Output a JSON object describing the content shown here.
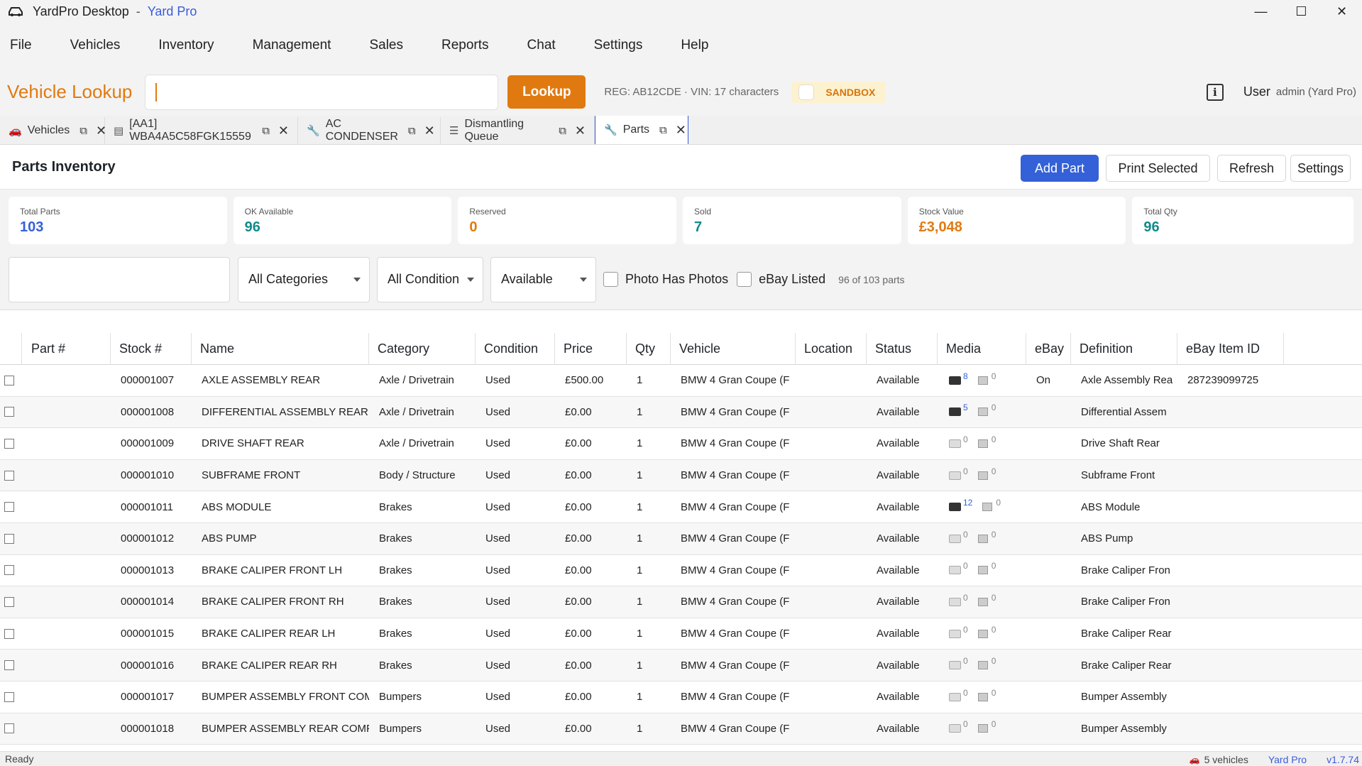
{
  "window": {
    "app_name": "YardPro Desktop",
    "separator": "-",
    "brand": "Yard Pro",
    "controls": {
      "minimize": "—",
      "maximize": "☐",
      "close": "✕"
    }
  },
  "menu": [
    "File",
    "Vehicles",
    "Inventory",
    "Management",
    "Sales",
    "Reports",
    "Chat",
    "Settings",
    "Help"
  ],
  "lookup": {
    "title": "Vehicle Lookup",
    "input_value": "",
    "button": "Lookup",
    "hint": "REG: AB12CDE · VIN: 17 characters",
    "sandbox_label": "SANDBOX",
    "user_label": "User",
    "user_value": "admin (Yard Pro)"
  },
  "tabs": [
    {
      "label": "Vehicles",
      "icon": "car-icon"
    },
    {
      "label": "[AA1] WBA4A5C58FGK15559",
      "icon": "document-icon"
    },
    {
      "label": "AC CONDENSER",
      "icon": "wrench-icon"
    },
    {
      "label": "Dismantling Queue",
      "icon": "queue-icon"
    },
    {
      "label": "Parts",
      "icon": "wrench-icon"
    }
  ],
  "parts": {
    "title": "Parts Inventory",
    "buttons": {
      "add": "Add Part",
      "print": "Print Selected",
      "refresh": "Refresh",
      "settings": "Settings"
    }
  },
  "stats": [
    {
      "label": "Total Parts",
      "value": "103",
      "color": "#3461d8"
    },
    {
      "label": "OK Available",
      "value": "96",
      "color": "#138a8a"
    },
    {
      "label": "Reserved",
      "value": "0",
      "color": "#e07a10"
    },
    {
      "label": "Sold",
      "value": "7",
      "color": "#138a8a"
    },
    {
      "label": "Stock Value",
      "value": "£3,048",
      "color": "#e07a10"
    },
    {
      "label": "Total Qty",
      "value": "96",
      "color": "#138a8a"
    }
  ],
  "filters": {
    "category": "All Categories",
    "condition": "All Condition",
    "status": "Available",
    "photo_label": "Photo Has Photos",
    "ebay_label": "eBay Listed",
    "count": "96 of 103 parts"
  },
  "columns": [
    "Part #",
    "Stock #",
    "Name",
    "Category",
    "Condition",
    "Price",
    "Qty",
    "Vehicle",
    "Location",
    "Status",
    "Media",
    "eBay",
    "Definition",
    "eBay Item ID"
  ],
  "rows": [
    {
      "part": "",
      "stock": "000001007",
      "name": "AXLE ASSEMBLY REAR",
      "category": "Axle / Drivetrain",
      "condition": "Used",
      "price": "£500.00",
      "qty": "1",
      "vehicle": "BMW 4 Gran Coupe (F",
      "location": "",
      "status": "Available",
      "photos": "8",
      "videos": "0",
      "ebay": "On",
      "definition": "Axle Assembly Rea",
      "ebay_id": "287239099725"
    },
    {
      "part": "",
      "stock": "000001008",
      "name": "DIFFERENTIAL ASSEMBLY REAR",
      "category": "Axle / Drivetrain",
      "condition": "Used",
      "price": "£0.00",
      "qty": "1",
      "vehicle": "BMW 4 Gran Coupe (F",
      "location": "",
      "status": "Available",
      "photos": "5",
      "videos": "0",
      "ebay": "",
      "definition": "Differential Assem",
      "ebay_id": ""
    },
    {
      "part": "",
      "stock": "000001009",
      "name": "DRIVE SHAFT REAR",
      "category": "Axle / Drivetrain",
      "condition": "Used",
      "price": "£0.00",
      "qty": "1",
      "vehicle": "BMW 4 Gran Coupe (F",
      "location": "",
      "status": "Available",
      "photos": "0",
      "videos": "0",
      "ebay": "",
      "definition": "Drive Shaft Rear",
      "ebay_id": ""
    },
    {
      "part": "",
      "stock": "000001010",
      "name": "SUBFRAME FRONT",
      "category": "Body / Structure",
      "condition": "Used",
      "price": "£0.00",
      "qty": "1",
      "vehicle": "BMW 4 Gran Coupe (F",
      "location": "",
      "status": "Available",
      "photos": "0",
      "videos": "0",
      "ebay": "",
      "definition": "Subframe Front",
      "ebay_id": ""
    },
    {
      "part": "",
      "stock": "000001011",
      "name": "ABS MODULE",
      "category": "Brakes",
      "condition": "Used",
      "price": "£0.00",
      "qty": "1",
      "vehicle": "BMW 4 Gran Coupe (F",
      "location": "",
      "status": "Available",
      "photos": "12",
      "videos": "0",
      "ebay": "",
      "definition": "ABS Module",
      "ebay_id": ""
    },
    {
      "part": "",
      "stock": "000001012",
      "name": "ABS PUMP",
      "category": "Brakes",
      "condition": "Used",
      "price": "£0.00",
      "qty": "1",
      "vehicle": "BMW 4 Gran Coupe (F",
      "location": "",
      "status": "Available",
      "photos": "0",
      "videos": "0",
      "ebay": "",
      "definition": "ABS Pump",
      "ebay_id": ""
    },
    {
      "part": "",
      "stock": "000001013",
      "name": "BRAKE CALIPER FRONT LH",
      "category": "Brakes",
      "condition": "Used",
      "price": "£0.00",
      "qty": "1",
      "vehicle": "BMW 4 Gran Coupe (F",
      "location": "",
      "status": "Available",
      "photos": "0",
      "videos": "0",
      "ebay": "",
      "definition": "Brake Caliper Fron",
      "ebay_id": ""
    },
    {
      "part": "",
      "stock": "000001014",
      "name": "BRAKE CALIPER FRONT RH",
      "category": "Brakes",
      "condition": "Used",
      "price": "£0.00",
      "qty": "1",
      "vehicle": "BMW 4 Gran Coupe (F",
      "location": "",
      "status": "Available",
      "photos": "0",
      "videos": "0",
      "ebay": "",
      "definition": "Brake Caliper Fron",
      "ebay_id": ""
    },
    {
      "part": "",
      "stock": "000001015",
      "name": "BRAKE CALIPER REAR LH",
      "category": "Brakes",
      "condition": "Used",
      "price": "£0.00",
      "qty": "1",
      "vehicle": "BMW 4 Gran Coupe (F",
      "location": "",
      "status": "Available",
      "photos": "0",
      "videos": "0",
      "ebay": "",
      "definition": "Brake Caliper Rear",
      "ebay_id": ""
    },
    {
      "part": "",
      "stock": "000001016",
      "name": "BRAKE CALIPER REAR RH",
      "category": "Brakes",
      "condition": "Used",
      "price": "£0.00",
      "qty": "1",
      "vehicle": "BMW 4 Gran Coupe (F",
      "location": "",
      "status": "Available",
      "photos": "0",
      "videos": "0",
      "ebay": "",
      "definition": "Brake Caliper Rear",
      "ebay_id": ""
    },
    {
      "part": "",
      "stock": "000001017",
      "name": "BUMPER ASSEMBLY FRONT COM",
      "category": "Bumpers",
      "condition": "Used",
      "price": "£0.00",
      "qty": "1",
      "vehicle": "BMW 4 Gran Coupe (F",
      "location": "",
      "status": "Available",
      "photos": "0",
      "videos": "0",
      "ebay": "",
      "definition": "Bumper Assembly",
      "ebay_id": ""
    },
    {
      "part": "",
      "stock": "000001018",
      "name": "BUMPER ASSEMBLY REAR COMPI",
      "category": "Bumpers",
      "condition": "Used",
      "price": "£0.00",
      "qty": "1",
      "vehicle": "BMW 4 Gran Coupe (F",
      "location": "",
      "status": "Available",
      "photos": "0",
      "videos": "0",
      "ebay": "",
      "definition": "Bumper Assembly",
      "ebay_id": ""
    }
  ],
  "statusbar": {
    "left": "Ready",
    "vehicles": "5 vehicles",
    "brand": "Yard Pro",
    "version": "v1.7.74"
  }
}
